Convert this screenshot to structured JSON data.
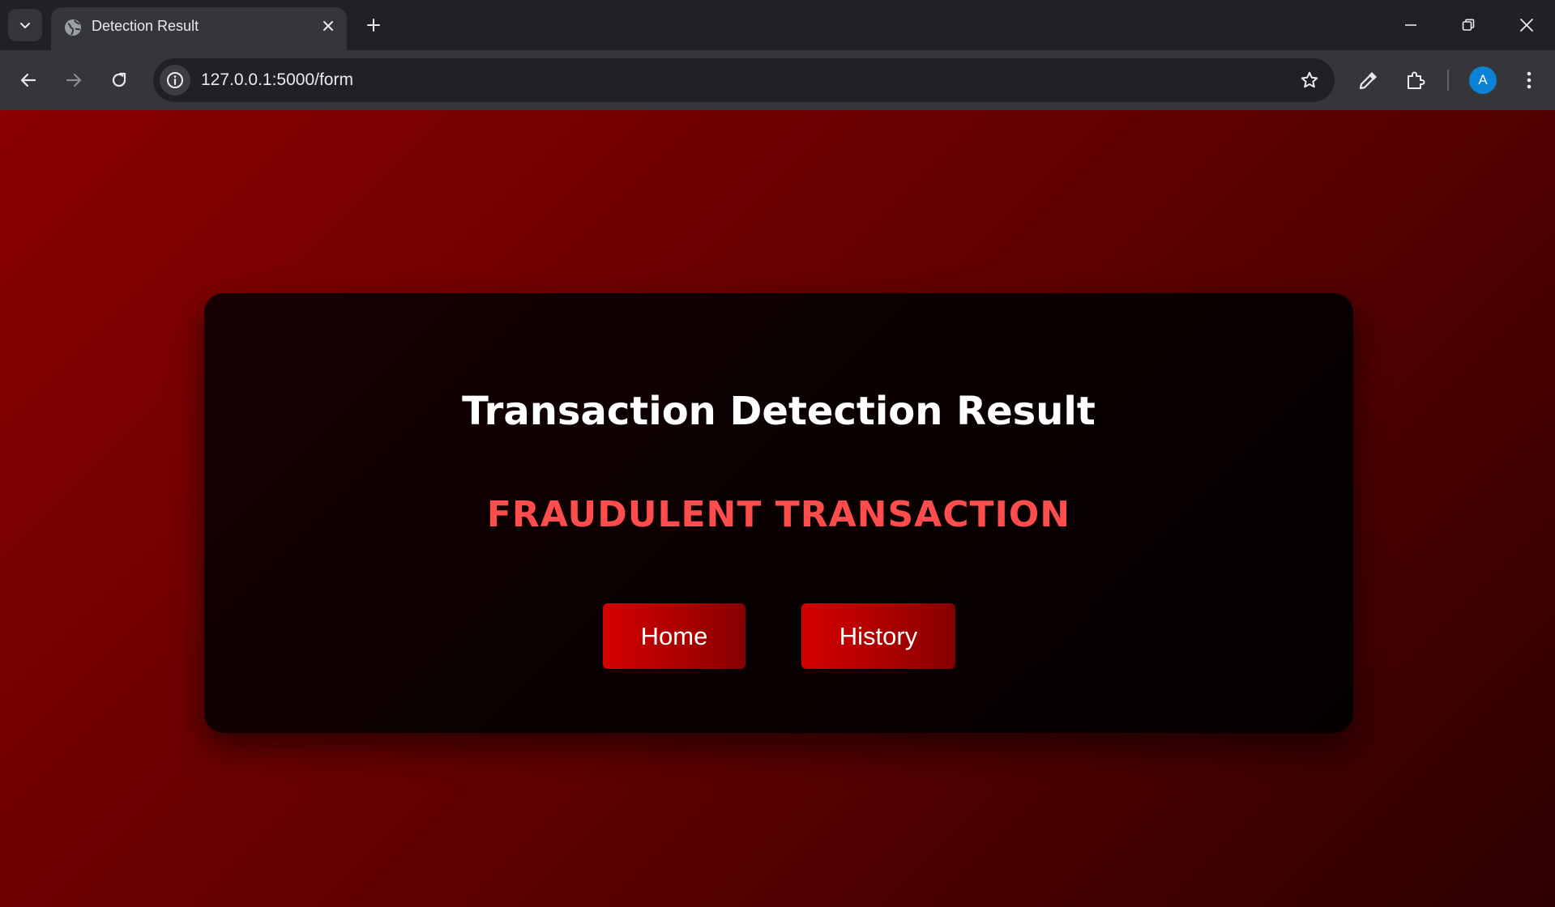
{
  "browser": {
    "tab": {
      "title": "Detection Result"
    },
    "address_bar": {
      "url": "127.0.0.1:5000/form"
    },
    "profile": {
      "initial": "A",
      "color": "#0b82d4"
    }
  },
  "page": {
    "title": "Transaction Detection Result",
    "status": "FRAUDULENT TRANSACTION",
    "status_color": "#ff4c4c",
    "buttons": {
      "home": "Home",
      "history": "History"
    },
    "colors": {
      "background_start": "#8b0000",
      "background_end": "#2e0000",
      "button_start": "#d40000",
      "button_end": "#850000"
    }
  }
}
